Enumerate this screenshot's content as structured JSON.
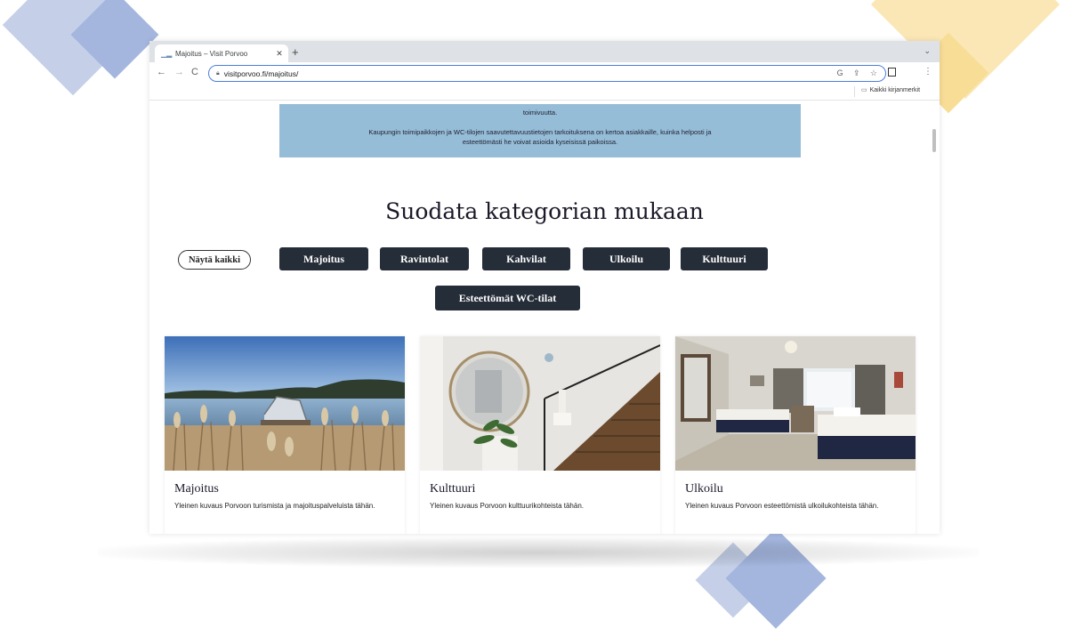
{
  "browser": {
    "tab_title": "Majoitus – Visit Porvoo",
    "url": "visitporvoo.fi/majoitus/",
    "bookmarks_label": "Kaikki kirjanmerkit"
  },
  "info_box": {
    "line1": "toimivuutta.",
    "line2": "Kaupungin toimipaikkojen ja WC-tilojen saavutettavuustietojen tarkoituksena on kertoa asiakkaille, kuinka helposti ja esteettömästi he voivat asioida kyseisissä paikoissa."
  },
  "filter": {
    "heading": "Suodata kategorian mukaan",
    "show_all": "Näytä kaikki",
    "buttons": [
      "Majoitus",
      "Ravintolat",
      "Kahvilat",
      "Ulkoilu",
      "Kulttuuri",
      "Esteettömät WC-tilat"
    ]
  },
  "cards": [
    {
      "title": "Majoitus",
      "desc": "Yleinen kuvaus Porvoon turismista ja majoituspalveluista tähän."
    },
    {
      "title": "Kulttuuri",
      "desc": "Yleinen kuvaus Porvoon kulttuurikohteista tähän."
    },
    {
      "title": "Ulkoilu",
      "desc": "Yleinen kuvaus Porvoon esteettömistä ulkoilukohteista tähän."
    }
  ],
  "colors": {
    "info_box": "#95bdd7",
    "button_bg": "#252d38",
    "deco_blue": "#a4b6de",
    "deco_yellow": "#fbe7b5"
  }
}
